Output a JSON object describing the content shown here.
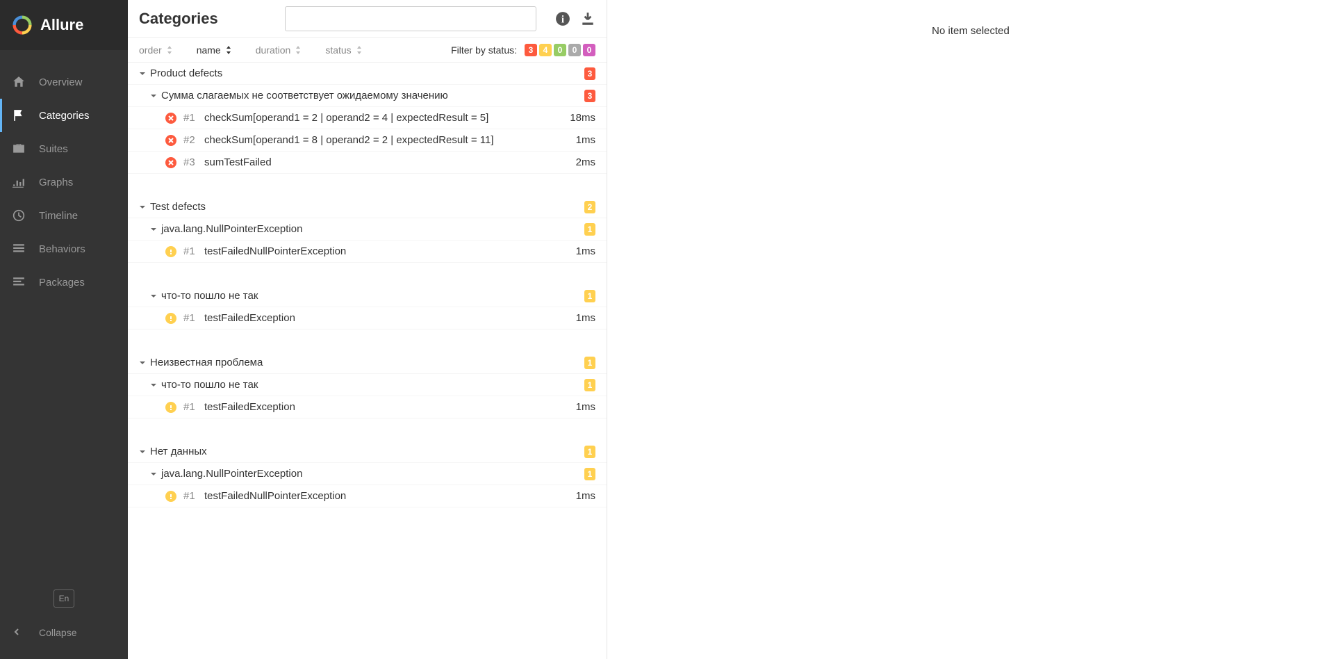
{
  "brand": "Allure",
  "nav": {
    "items": [
      {
        "label": "Overview"
      },
      {
        "label": "Categories"
      },
      {
        "label": "Suites"
      },
      {
        "label": "Graphs"
      },
      {
        "label": "Timeline"
      },
      {
        "label": "Behaviors"
      },
      {
        "label": "Packages"
      }
    ]
  },
  "lang": "En",
  "collapse": "Collapse",
  "header": {
    "title": "Categories"
  },
  "sorters": {
    "order": "order",
    "name": "name",
    "duration": "duration",
    "status": "status"
  },
  "filter": {
    "label": "Filter by status:",
    "failed": "3",
    "broken": "4",
    "passed": "0",
    "skipped": "0",
    "unknown": "0"
  },
  "tree": {
    "g0": {
      "title": "Product defects",
      "badge": "3"
    },
    "g0s0": {
      "title": "Сумма слагаемых не соответствует ожидаемому значению",
      "badge": "3"
    },
    "g0s0t0": {
      "idx": "#1",
      "name": "checkSum[operand1 = 2 | operand2 = 4 | expectedResult = 5]",
      "dur": "18ms"
    },
    "g0s0t1": {
      "idx": "#2",
      "name": "checkSum[operand1 = 8 | operand2 = 2 | expectedResult = 11]",
      "dur": "1ms"
    },
    "g0s0t2": {
      "idx": "#3",
      "name": "sumTestFailed",
      "dur": "2ms"
    },
    "g1": {
      "title": "Test defects",
      "badge": "2"
    },
    "g1s0": {
      "title": "java.lang.NullPointerException",
      "badge": "1"
    },
    "g1s0t0": {
      "idx": "#1",
      "name": "testFailedNullPointerException",
      "dur": "1ms"
    },
    "g1s1": {
      "title": "что-то пошло не так",
      "badge": "1"
    },
    "g1s1t0": {
      "idx": "#1",
      "name": "testFailedException",
      "dur": "1ms"
    },
    "g2": {
      "title": "Неизвестная проблема",
      "badge": "1"
    },
    "g2s0": {
      "title": "что-то пошло не так",
      "badge": "1"
    },
    "g2s0t0": {
      "idx": "#1",
      "name": "testFailedException",
      "dur": "1ms"
    },
    "g3": {
      "title": "Нет данных",
      "badge": "1"
    },
    "g3s0": {
      "title": "java.lang.NullPointerException",
      "badge": "1"
    },
    "g3s0t0": {
      "idx": "#1",
      "name": "testFailedNullPointerException",
      "dur": "1ms"
    }
  },
  "detail": {
    "empty": "No item selected"
  }
}
